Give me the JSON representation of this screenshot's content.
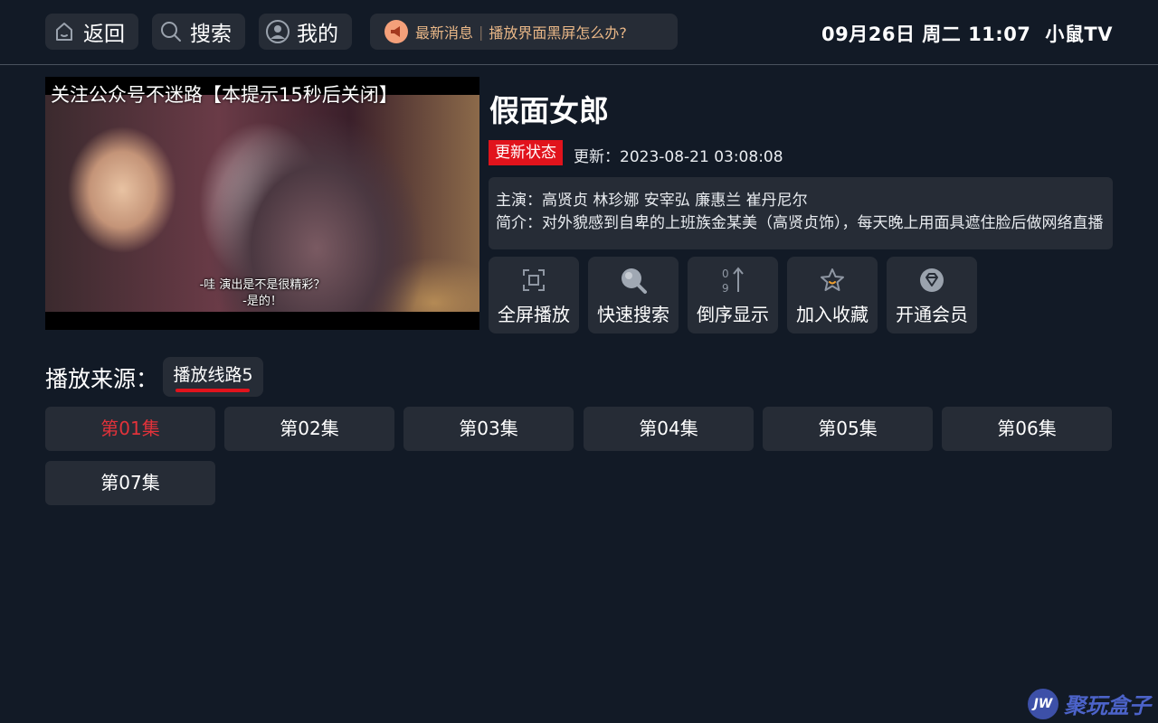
{
  "topbar": {
    "back_label": "返回",
    "search_label": "搜索",
    "profile_label": "我的",
    "news_title": "最新消息",
    "news_text": "播放界面黑屏怎么办?",
    "datetime": "09月26日 周二 11:07",
    "app_name": "小鼠TV"
  },
  "player": {
    "overlay_notice": "关注公众号不迷路【本提示15秒后关闭】",
    "subtitle_line1": "-哇 演出是不是很精彩？",
    "subtitle_line2": "-是的！"
  },
  "detail": {
    "title": "假面女郎",
    "status_badge": "更新状态",
    "updated": "更新：2023-08-21 03:08:08",
    "cast": "主演：高贤贞 林珍娜 安宰弘 廉惠兰 崔丹尼尔",
    "synopsis": "简介：对外貌感到自卑的上班族金某美（高贤贞饰），每天晚上用面具遮住脸后做网络直播"
  },
  "actions": [
    {
      "label": "全屏播放",
      "icon": "fullscreen-icon"
    },
    {
      "label": "快速搜索",
      "icon": "search-icon"
    },
    {
      "label": "倒序显示",
      "icon": "sort-icon"
    },
    {
      "label": "加入收藏",
      "icon": "star-icon"
    },
    {
      "label": "开通会员",
      "icon": "diamond-icon"
    }
  ],
  "source": {
    "label": "播放来源：",
    "selected": "播放线路5"
  },
  "episodes": [
    "第01集",
    "第02集",
    "第03集",
    "第04集",
    "第05集",
    "第06集",
    "第07集"
  ],
  "active_episode": "第01集",
  "watermark": {
    "logo_text": "JW",
    "text": "聚玩盒子"
  },
  "colors": {
    "background": "#121a26",
    "panel": "#262c36",
    "accent_red": "#e1131c",
    "news_text": "#e9b787"
  }
}
